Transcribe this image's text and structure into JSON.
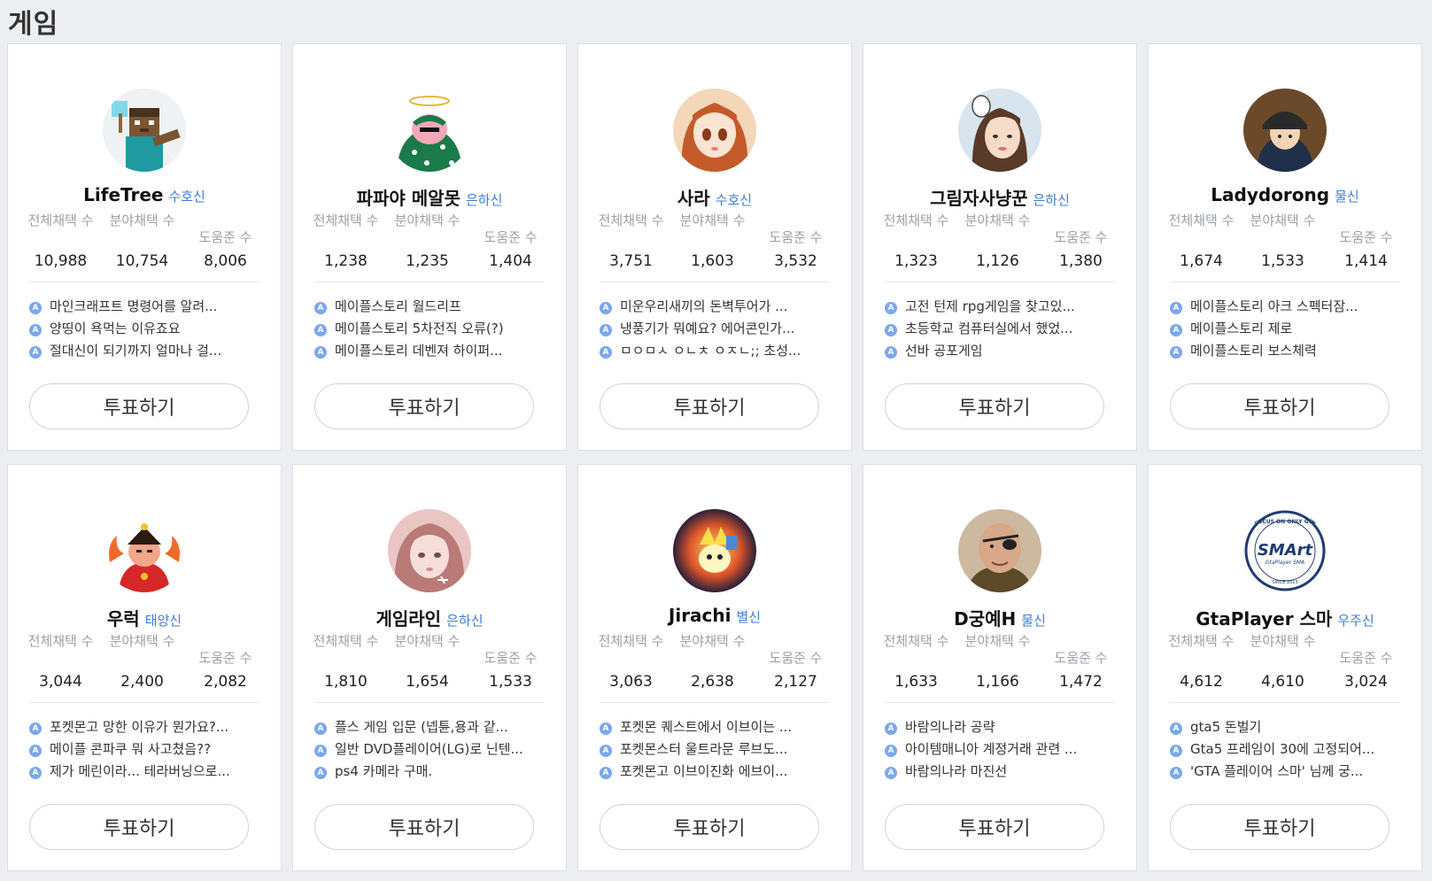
{
  "section": {
    "title": "게임"
  },
  "stat_labels": {
    "total": "전체채택 수",
    "field": "분야채택 수",
    "help": "도움준 수"
  },
  "vote_label": "투표하기",
  "qa_icon": "A",
  "cards": [
    {
      "name": "LifeTree",
      "rank": "수호신",
      "total": "10,988",
      "field": "10,754",
      "help": "8,006",
      "qa": [
        "마인크래프트 명령어를 알려...",
        "양띵이 욕먹는 이유죠요",
        "절대신이 되기까지 얼마나 걸..."
      ]
    },
    {
      "name": "파파야 메알못",
      "rank": "은하신",
      "total": "1,238",
      "field": "1,235",
      "help": "1,404",
      "qa": [
        "메이플스토리 월드리프",
        "메이플스토리 5차전직 오류(?)",
        "메이플스토리 데벤져 하이퍼..."
      ]
    },
    {
      "name": "사라",
      "rank": "수호신",
      "total": "3,751",
      "field": "1,603",
      "help": "3,532",
      "qa": [
        "미운우리새끼의 돈벽투어가 ...",
        "냉풍기가 뭐예요? 에어콘인가...",
        "ㅁㅇㅁㅅ ㅇㄴㅊ ㅇㅈㄴ;; 초성..."
      ]
    },
    {
      "name": "그림자사냥꾼",
      "rank": "은하신",
      "total": "1,323",
      "field": "1,126",
      "help": "1,380",
      "qa": [
        "고전 턴제 rpg게임을 찾고있...",
        "초등학교 컴퓨터실에서 했었...",
        "선바 공포게임"
      ]
    },
    {
      "name": "Ladydorong",
      "rank": "물신",
      "total": "1,674",
      "field": "1,533",
      "help": "1,414",
      "qa": [
        "메이플스토리 아크 스펙터잠...",
        "메이플스토리 제로",
        "메이플스토리 보스체력"
      ]
    },
    {
      "name": "우럭",
      "rank": "태양신",
      "total": "3,044",
      "field": "2,400",
      "help": "2,082",
      "qa": [
        "포켓몬고 망한 이유가 뭔가요?...",
        "메이플 콘파쿠 뭐 사고쳤음??",
        "제가 메린이라... 테라버닝으로..."
      ]
    },
    {
      "name": "게임라인",
      "rank": "은하신",
      "total": "1,810",
      "field": "1,654",
      "help": "1,533",
      "qa": [
        "플스 게임 입문 (넵튠,용과 같...",
        "일반 DVD플레이어(LG)로 닌텐...",
        "ps4 카메라 구매."
      ]
    },
    {
      "name": "Jirachi",
      "rank": "별신",
      "total": "3,063",
      "field": "2,638",
      "help": "2,127",
      "qa": [
        "포켓몬 퀘스트에서 이브이는 ...",
        "포켓몬스터 울트라문 루브도...",
        "포켓몬고 이브이진화 에브이..."
      ]
    },
    {
      "name": "D궁예H",
      "rank": "물신",
      "total": "1,633",
      "field": "1,166",
      "help": "1,472",
      "qa": [
        "바람의나라 공략",
        "아이템매니아 계정거래 관련 ...",
        "바람의나라 마진선"
      ]
    },
    {
      "name": "GtaPlayer 스마",
      "rank": "우주신",
      "total": "4,612",
      "field": "4,610",
      "help": "3,024",
      "qa": [
        "gta5 돈벌기",
        "Gta5 프레임이 30에 고정되어...",
        "'GTA 플레이어 스마' 님께 궁..."
      ]
    }
  ],
  "avatar_logo": {
    "text": "SMArt",
    "ring_top": "FOCUS ON ONLY GTA",
    "sub": "GtaPlayer SMA",
    "ring_bottom": "SINCE 2015"
  }
}
